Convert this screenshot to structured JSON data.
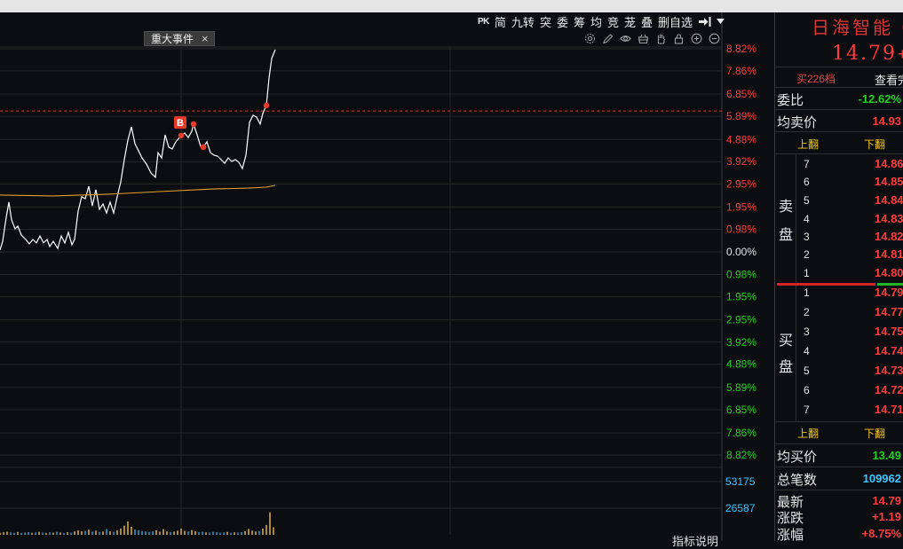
{
  "toolbar": {
    "items": [
      "PK",
      "简",
      "九转",
      "突",
      "委",
      "筹",
      "均",
      "竞",
      "茏",
      "叠",
      "删自选"
    ],
    "export_icon": "exit-arrow-icon",
    "dropdown_icon": "dropdown-triangle-icon"
  },
  "event_tag": {
    "label": "重大事件",
    "close": "×"
  },
  "chart_tools": [
    "gear-icon",
    "pencil-icon",
    "eye-icon",
    "basket-icon",
    "hand-icon",
    "lock-icon",
    "zoom-in-icon",
    "zoom-out-icon"
  ],
  "footer": {
    "indicator_help": "指标说明"
  },
  "quote": {
    "name": "日海智能 0",
    "price": "14.79",
    "price_suffix": "+",
    "depth_link": "买226档",
    "view_full": "查看完",
    "weibi_label": "委比",
    "weibi_value": "-12.62%",
    "avg_ask_label": "均卖价",
    "avg_ask_value": "14.93",
    "page_up": "上翻",
    "page_down": "下翻",
    "ask_side": [
      "卖",
      "盘"
    ],
    "asks": [
      {
        "level": "7",
        "price": "14.86"
      },
      {
        "level": "6",
        "price": "14.85"
      },
      {
        "level": "5",
        "price": "14.84"
      },
      {
        "level": "4",
        "price": "14.83"
      },
      {
        "level": "3",
        "price": "14.82"
      },
      {
        "level": "2",
        "price": "14.81"
      },
      {
        "level": "1",
        "price": "14.80"
      }
    ],
    "bid_side": [
      "买",
      "盘"
    ],
    "bids": [
      {
        "level": "1",
        "price": "14.79"
      },
      {
        "level": "2",
        "price": "14.77"
      },
      {
        "level": "3",
        "price": "14.75"
      },
      {
        "level": "4",
        "price": "14.74"
      },
      {
        "level": "5",
        "price": "14.73"
      },
      {
        "level": "6",
        "price": "14.72"
      },
      {
        "level": "7",
        "price": "14.71"
      }
    ],
    "avg_bid_label": "均买价",
    "avg_bid_value": "13.49",
    "trades_label": "总笔数",
    "trades_value": "109962",
    "last_label": "最新",
    "last_value": "14.79",
    "change_label": "涨跌",
    "change_value": "+1.19",
    "pct_label": "涨幅",
    "pct_value": "+8.75%"
  },
  "colors": {
    "up": "#ff3b3b",
    "down": "#1fd31f",
    "flat": "#e6e6e6",
    "volume_axis": "#3fc6ff",
    "price_line": "#ffffff",
    "avg_line": "#e0a030",
    "marker": "#e53a2a",
    "vol_up": "#f0c040",
    "vol_down": "#3aa8e0",
    "ref_line": "#c83232"
  },
  "chart_data": {
    "type": "line",
    "x_range": [
      0,
      203.25
    ],
    "ylim": [
      -8.82,
      8.82
    ],
    "series": [
      {
        "color": "#ffffff",
        "points": [
          [
            0,
            0.08
          ],
          [
            0.75,
            0.46
          ],
          [
            1.75,
            1.5
          ],
          [
            2.5,
            2.16
          ],
          [
            3.25,
            1.39
          ],
          [
            4.25,
            1.0
          ],
          [
            5,
            1.12
          ],
          [
            6,
            0.73
          ],
          [
            7.25,
            0.54
          ],
          [
            8.25,
            0.35
          ],
          [
            9.25,
            0.54
          ],
          [
            10.25,
            0.39
          ],
          [
            11.25,
            0.69
          ],
          [
            12.25,
            0.39
          ],
          [
            13.25,
            0.54
          ],
          [
            14,
            0.23
          ],
          [
            15,
            0.46
          ],
          [
            16.25,
            0.15
          ],
          [
            17.25,
            0.69
          ],
          [
            18.25,
            0.39
          ],
          [
            19.25,
            0.85
          ],
          [
            20.25,
            0.31
          ],
          [
            21,
            0.54
          ],
          [
            22,
            1.77
          ],
          [
            23,
            2.39
          ],
          [
            24,
            2.31
          ],
          [
            25,
            2.85
          ],
          [
            26,
            2.0
          ],
          [
            27,
            2.7
          ],
          [
            28,
            1.85
          ],
          [
            29,
            2.08
          ],
          [
            30,
            1.69
          ],
          [
            31,
            2.16
          ],
          [
            32,
            1.69
          ],
          [
            33,
            2.39
          ],
          [
            34,
            3.04
          ],
          [
            35,
            4.01
          ],
          [
            36,
            4.85
          ],
          [
            37,
            5.43
          ],
          [
            38,
            4.7
          ],
          [
            39,
            4.39
          ],
          [
            40,
            4.08
          ],
          [
            41.25,
            3.81
          ],
          [
            42.5,
            3.43
          ],
          [
            43.75,
            3.24
          ],
          [
            44.5,
            4.31
          ],
          [
            45.5,
            4.08
          ],
          [
            46.5,
            5.08
          ],
          [
            47.5,
            4.55
          ],
          [
            48.5,
            4.47
          ],
          [
            49.5,
            4.78
          ],
          [
            51,
            5.05
          ],
          [
            52,
            5.16
          ],
          [
            53,
            4.97
          ],
          [
            54,
            5.24
          ],
          [
            54.5,
            5.55
          ],
          [
            55.5,
            5.08
          ],
          [
            56.5,
            4.58
          ],
          [
            57.25,
            4.55
          ],
          [
            58.25,
            4.78
          ],
          [
            59.25,
            4.31
          ],
          [
            60.25,
            4.2
          ],
          [
            61.25,
            4.16
          ],
          [
            62.25,
            4.01
          ],
          [
            63.25,
            3.85
          ],
          [
            64.25,
            4.08
          ],
          [
            65.25,
            3.93
          ],
          [
            66.25,
            4.01
          ],
          [
            67.25,
            3.89
          ],
          [
            68.25,
            3.62
          ],
          [
            69.25,
            4.2
          ],
          [
            70.25,
            5.62
          ],
          [
            71.25,
            5.93
          ],
          [
            72.25,
            5.85
          ],
          [
            73.25,
            5.55
          ],
          [
            74,
            6.01
          ],
          [
            75,
            6.36
          ],
          [
            75.75,
            7.55
          ],
          [
            76.5,
            8.4
          ],
          [
            77.5,
            8.78
          ]
        ]
      },
      {
        "color": "#e0a030",
        "points": [
          [
            0,
            2.47
          ],
          [
            15,
            2.43
          ],
          [
            30,
            2.5
          ],
          [
            45,
            2.62
          ],
          [
            60,
            2.73
          ],
          [
            70,
            2.77
          ],
          [
            75,
            2.81
          ],
          [
            77.5,
            2.89
          ]
        ]
      }
    ],
    "markers": [
      [
        51,
        5.05
      ],
      [
        54.5,
        5.55
      ],
      [
        57.25,
        4.55
      ],
      [
        75,
        6.36
      ]
    ],
    "signal": {
      "label": "B",
      "x": 50.75,
      "y": 5.62
    },
    "ref_line": 6.12,
    "y_ticks": [
      {
        "label": "8.82%",
        "value": 8.82
      },
      {
        "label": "7.86%",
        "value": 7.86
      },
      {
        "label": "6.85%",
        "value": 6.85
      },
      {
        "label": "5.89%",
        "value": 5.89
      },
      {
        "label": "4.88%",
        "value": 4.88
      },
      {
        "label": "3.92%",
        "value": 3.92
      },
      {
        "label": "2.95%",
        "value": 2.95
      },
      {
        "label": "1.95%",
        "value": 1.95
      },
      {
        "label": "0.98%",
        "value": 0.98
      },
      {
        "label": "0.00%",
        "value": 0
      },
      {
        "label": "0.98%",
        "value": -0.98
      },
      {
        "label": "1.95%",
        "value": -1.95
      },
      {
        "label": "2.95%",
        "value": -2.95
      },
      {
        "label": "3.92%",
        "value": -3.92
      },
      {
        "label": "4.88%",
        "value": -4.88
      },
      {
        "label": "5.89%",
        "value": -5.89
      },
      {
        "label": "6.85%",
        "value": -6.85
      },
      {
        "label": "7.86%",
        "value": -7.86
      },
      {
        "label": "8.82%",
        "value": -8.82
      }
    ],
    "volume": {
      "ylim": [
        0,
        53175
      ],
      "ticks": [
        {
          "label": "53175",
          "value": 53175
        },
        {
          "label": "26587",
          "value": 26587
        }
      ],
      "values": [
        2100,
        2600,
        3100,
        2400,
        2000,
        2800,
        1900,
        2300,
        2700,
        2000,
        2400,
        3000,
        2200,
        1800,
        2500,
        2100,
        2900,
        2300,
        1900,
        2600,
        2200,
        3400,
        4300,
        3600,
        3900,
        5200,
        3100,
        4100,
        2800,
        3300,
        5800,
        3600,
        2900,
        4400,
        6300,
        9200,
        13400,
        8100,
        5200,
        4600,
        3800,
        3300,
        2900,
        3500,
        4400,
        3100,
        5600,
        3400,
        2800,
        3200,
        4100,
        6100,
        3900,
        3300,
        4800,
        3600,
        2700,
        3100,
        2500,
        2300,
        2900,
        2600,
        2200,
        2400,
        2800,
        2100,
        2500,
        2300,
        2700,
        3600,
        5900,
        4200,
        3300,
        3800,
        6200,
        9800,
        22400,
        7600
      ]
    }
  }
}
